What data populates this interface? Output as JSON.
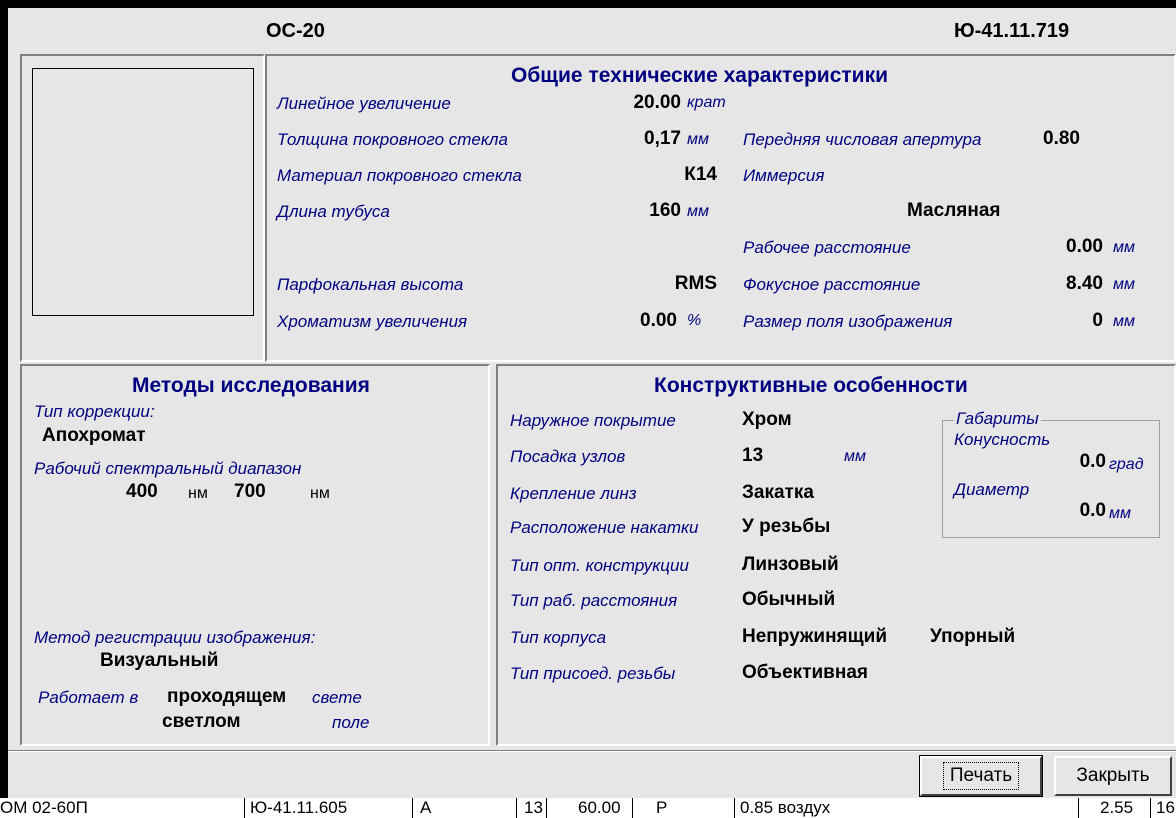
{
  "header": {
    "model": "ОС-20",
    "code": "Ю-41.11.719"
  },
  "general": {
    "title": "Общие технические характеристики",
    "magnification_label": "Линейное увеличение",
    "magnification_value": "20.00",
    "magnification_unit": "крат",
    "cover_thickness_label": "Толщина покровного стекла",
    "cover_thickness_value": "0,17",
    "cover_thickness_unit": "мм",
    "aperture_label": "Передняя числовая апертура",
    "aperture_value": "0.80",
    "cover_material_label": "Материал покровного стекла",
    "cover_material_value": "К14",
    "immersion_label": "Иммерсия",
    "immersion_value": "Масляная",
    "tube_length_label": "Длина тубуса",
    "tube_length_value": "160",
    "tube_length_unit": "мм",
    "working_distance_label": "Рабочее расстояние",
    "working_distance_value": "0.00",
    "working_distance_unit": "мм",
    "parfocal_label": "Парфокальная высота",
    "parfocal_value": "RMS",
    "focal_length_label": "Фокусное расстояние",
    "focal_length_value": "8.40",
    "focal_length_unit": "мм",
    "chromatism_label": "Хроматизм увеличения",
    "chromatism_value": "0.00",
    "chromatism_unit": "%",
    "field_size_label": "Размер поля изображения",
    "field_size_value": "0",
    "field_size_unit": "мм"
  },
  "methods": {
    "title": "Методы исследования",
    "correction_label": "Тип коррекции:",
    "correction_value": "Апохромат",
    "spectral_label": "Рабочий спектральный диапазон",
    "spectral_from": "400",
    "spectral_from_unit": "нм",
    "spectral_to": "700",
    "spectral_to_unit": "нм",
    "registration_label": "Метод регистрации изображения:",
    "registration_value": "Визуальный",
    "works_in_label": "Работает в",
    "works_in_light_value": "проходящем",
    "works_in_light_suffix": "свете",
    "works_in_field_value": "светлом",
    "works_in_field_suffix": "поле"
  },
  "design": {
    "title": "Конструктивные особенности",
    "coating_label": "Наружное покрытие",
    "coating_value": "Хром",
    "fit_label": "Посадка узлов",
    "fit_value": "13",
    "fit_unit": "мм",
    "lens_mount_label": "Крепление линз",
    "lens_mount_value": "Закатка",
    "knurl_label": "Расположение накатки",
    "knurl_value": "У резьбы",
    "optics_type_label": "Тип опт. конструкции",
    "optics_type_value": "Линзовый",
    "work_dist_type_label": "Тип раб. расстояния",
    "work_dist_type_value": "Обычный",
    "body_type_label": "Тип корпуса",
    "body_type_value1": "Непружинящий",
    "body_type_value2": "Упорный",
    "thread_type_label": "Тип присоед. резьбы",
    "thread_type_value": "Объективная",
    "dims": {
      "legend": "Габариты",
      "taper_label": "Конусность",
      "taper_value": "0.0",
      "taper_unit": "град",
      "diameter_label": "Диаметр",
      "diameter_value": "0.0",
      "diameter_unit": "мм"
    }
  },
  "buttons": {
    "print": "Печать",
    "close": "Закрыть"
  },
  "background_row": {
    "c1": "ОМ 02-60П",
    "c2": "Ю-41.11.605",
    "c3": "А",
    "c4": "13",
    "c5": "60.00",
    "c6": "Р",
    "c7": "0.85 воздух",
    "c8": "2.55",
    "c9": "16"
  }
}
